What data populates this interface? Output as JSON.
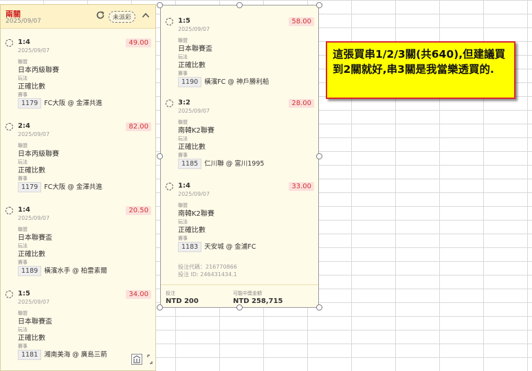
{
  "colors": {
    "odds": "#d23333",
    "accent": "#cc2222",
    "callout_bg": "#ffff00",
    "callout_border": "#d8262f"
  },
  "left": {
    "title": "兩關",
    "date": "2025/09/07",
    "status": "未派彩",
    "legs": [
      {
        "score": "1:4",
        "date": "2025/09/07",
        "odds": "49.00",
        "league_label": "聯盟",
        "league": "日本丙級聯賽",
        "play_label": "玩法",
        "play": "正確比數",
        "match_label": "賽事",
        "match_id": "1179",
        "match": "FC大阪 @ 金澤共進"
      },
      {
        "score": "2:4",
        "date": "2025/09/07",
        "odds": "82.00",
        "league_label": "聯盟",
        "league": "日本丙級聯賽",
        "play_label": "玩法",
        "play": "正確比數",
        "match_label": "賽事",
        "match_id": "1179",
        "match": "FC大阪 @ 金澤共進"
      },
      {
        "score": "1:4",
        "date": "2025/09/07",
        "odds": "20.50",
        "league_label": "聯盟",
        "league": "日本聯賽盃",
        "play_label": "玩法",
        "play": "正確比數",
        "match_label": "賽事",
        "match_id": "1189",
        "match": "橫濱水手 @ 柏雷素爾"
      },
      {
        "score": "1:5",
        "date": "2025/09/07",
        "odds": "34.00",
        "league_label": "聯盟",
        "league": "日本聯賽盃",
        "play_label": "玩法",
        "play": "正確比數",
        "match_label": "賽事",
        "match_id": "1181",
        "match": "湘南美海 @ 廣島三箭"
      }
    ]
  },
  "right": {
    "legs": [
      {
        "score": "1:5",
        "date": "2025/09/07",
        "odds": "58.00",
        "league_label": "聯盟",
        "league": "日本聯賽盃",
        "play_label": "玩法",
        "play": "正確比數",
        "match_label": "賽事",
        "match_id": "1190",
        "match": "橫濱FC @ 神戶勝利船"
      },
      {
        "score": "3:2",
        "date": "2025/09/07",
        "odds": "28.00",
        "league_label": "聯盟",
        "league": "南韓K2聯賽",
        "play_label": "玩法",
        "play": "正確比數",
        "match_label": "賽事",
        "match_id": "1185",
        "match": "仁川聯 @ 富川1995"
      },
      {
        "score": "1:4",
        "date": "2025/09/07",
        "odds": "33.00",
        "league_label": "聯盟",
        "league": "南韓K2聯賽",
        "play_label": "玩法",
        "play": "正確比數",
        "match_label": "賽事",
        "match_id": "1183",
        "match": "天安城 @ 金浦FC"
      }
    ],
    "bet_code": "投注代碼：216770866",
    "bet_id": "投注 ID: 246431434.1",
    "stake_label": "投注",
    "stake": "NTD 200",
    "payout_label": "可能中獎金額",
    "payout": "NTD 258,715"
  },
  "callout": {
    "text": "這張買串1/2/3關(共640),但建議買到2關就好,串3關是我當樂透買的."
  }
}
